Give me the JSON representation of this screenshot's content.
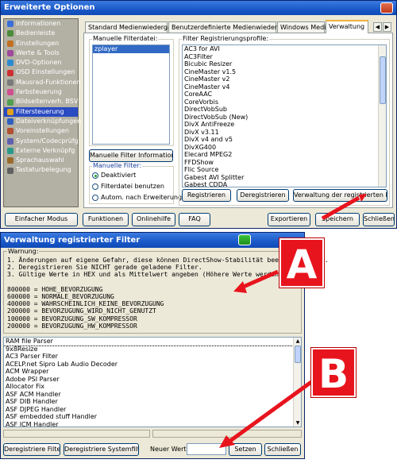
{
  "options_window": {
    "title": "Erweiterte Optionen",
    "sidebar": [
      {
        "label": "Informationen",
        "color": "#3a6fd8"
      },
      {
        "label": "Bedienleiste",
        "color": "#4c8c3c"
      },
      {
        "label": "Einstellungen",
        "color": "#c07020"
      },
      {
        "label": "Werte & Tools",
        "color": "#a04a9c"
      },
      {
        "label": "DVD-Optionen",
        "color": "#2c8ad0"
      },
      {
        "label": "OSD Einstellungen",
        "color": "#cc3030"
      },
      {
        "label": "Mausrad-Funktionen",
        "color": "#7a7a7a"
      },
      {
        "label": "Farbsteuerung",
        "color": "#d05090"
      },
      {
        "label": "Bildseitenverh. BSV",
        "color": "#50a050"
      },
      {
        "label": "Filtersteuerung",
        "color": "#e0a020"
      },
      {
        "label": "Dateiverknüpfungen",
        "color": "#3060c0"
      },
      {
        "label": "Voreinstellungen",
        "color": "#b05030"
      },
      {
        "label": "System/Codecprüfg",
        "color": "#6060b0"
      },
      {
        "label": "Externe Verknüpfg",
        "color": "#2a9a8a"
      },
      {
        "label": "Sprachauswahl",
        "color": "#9a6a2a"
      },
      {
        "label": "Tastaturbelegung",
        "color": "#606060"
      }
    ],
    "selected_sidebar_index": 9,
    "tabs": [
      "Standard Medienwiedergabe",
      "Benutzerdefinierte Medienwiedergabe",
      "Windows Media",
      "Verwaltung"
    ],
    "active_tab": "Verwaltung",
    "manual_filter_label": "Manuelle Filterdatei:",
    "manual_filter_items": [
      "zplayer"
    ],
    "manual_filter_info_button": "Manuelle Filter Information",
    "manual_filter_group_label": "Manuelle Filter:",
    "radio_options": [
      {
        "label": "Deaktiviert",
        "checked": true
      },
      {
        "label": "Filterdatei benutzen",
        "checked": false
      },
      {
        "label": "Autom. nach Erweiterung",
        "checked": false
      }
    ],
    "filter_profiles_label": "Filter Registrierungsprofile:",
    "filter_profiles": [
      "AC3 for AVI",
      "AC3Filter",
      "Bicubic Resizer",
      "CineMaster v1.5",
      "CineMaster v2",
      "CineMaster v4",
      "CoreAAC",
      "CoreVorbis",
      "DirectVobSub",
      "DirectVobSub (New)",
      "DivX AntiFreeze",
      "DivX v3.11",
      "DivX v4 and v5",
      "DivXG400",
      "Elecard MPEG2",
      "FFDShow",
      "Flic Source",
      "Gabest AVI Splitter",
      "Gabest CDDA"
    ],
    "register_button": "Registrieren",
    "deregister_button": "Deregistrieren",
    "manage_registered_button": "Verwaltung der registrierten Fi",
    "bottom_buttons": {
      "simple_mode": "Einfacher Modus",
      "functions": "Funktionen",
      "online_help": "Onlinehilfe",
      "faq": "FAQ",
      "export": "Exportieren",
      "save": "Speichern",
      "close": "Schließen"
    }
  },
  "registered_window": {
    "title": "Verwaltung registrierter Filter",
    "warning_label": "Warnung:",
    "warning_lines": [
      "1. Änderungen auf eigene Gefahr, diese können DirectShow-Stabilität beeinträchtigen.",
      "2. Deregistrieren Sie NICHT gerade geladene Filter.",
      "3. Gültige Werte in HEX und als Mittelwert angeben (Höhere Werte werden bevorzugt):",
      "",
      "800000 = HOHE_BEVORZUGUNG",
      "600000 = NORMALE_BEVORZUGUNG",
      "400000 = WAHRSCHEINLICH_KEINE_BEVORZUGUNG",
      "200000 = BEVORZUGUNG_WIRD_NICHT_GENUTZT",
      "100000 = BEVORZUGUNG_SW_KOMPRESSOR",
      "200000 = BEVORZUGUNG_HW_KOMPRESSOR"
    ],
    "filters": [
      "RAM file Parser",
      "9x8Resize",
      "AC3 Parser Filter",
      "ACELP.net Sipro Lab Audio Decoder",
      "ACM Wrapper",
      "Adobe PSI Parser",
      "Allocator Fix",
      "ASF ACM Handler",
      "ASF DIB Handler",
      "ASF DJPEG Handler",
      "ASF embedded stuff Handler",
      "ASF ICM Handler"
    ],
    "deregister_filter_button": "Deregistriere Filter",
    "deregister_system_button": "Deregistriere Systemfilter",
    "new_value_label": "Neuer Wert:",
    "new_value": "",
    "set_button": "Setzen",
    "close_button": "Schließen"
  },
  "callouts": {
    "a": "A",
    "b": "B",
    "color": "#e8141d"
  }
}
